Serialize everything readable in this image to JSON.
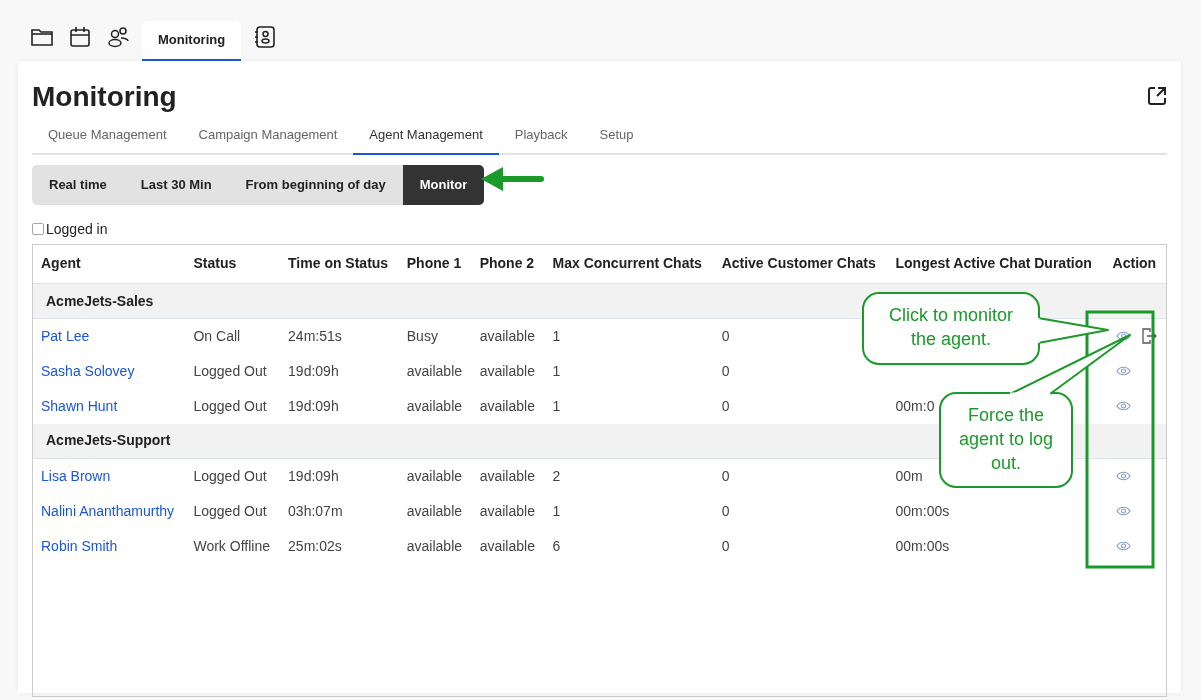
{
  "app_tabs": [
    {
      "kind": "folder",
      "selected": false
    },
    {
      "kind": "calendar",
      "selected": false
    },
    {
      "kind": "people",
      "selected": false
    },
    {
      "kind": "text",
      "label": "Monitoring",
      "selected": true
    },
    {
      "kind": "contact",
      "selected": false
    }
  ],
  "page": {
    "title": "Monitoring"
  },
  "tabs": [
    {
      "label": "Queue Management",
      "selected": false
    },
    {
      "label": "Campaign Management",
      "selected": false
    },
    {
      "label": "Agent Management",
      "selected": true
    },
    {
      "label": "Playback",
      "selected": false
    },
    {
      "label": "Setup",
      "selected": false
    }
  ],
  "modes": [
    {
      "label": "Real time",
      "selected": false
    },
    {
      "label": "Last 30 Min",
      "selected": false
    },
    {
      "label": "From beginning of day",
      "selected": false
    },
    {
      "label": "Monitor",
      "selected": true
    }
  ],
  "filter": {
    "label": "Logged in",
    "checked": false
  },
  "table": {
    "columns": [
      "Agent",
      "Status",
      "Time on Status",
      "Phone 1",
      "Phone 2",
      "Max Concurrent Chats",
      "Active Customer Chats",
      "Longest Active Chat Duration",
      "Action"
    ],
    "groups": [
      {
        "name": "AcmeJets-Sales",
        "rows": [
          {
            "agent": "Pat Lee",
            "status": "On Call",
            "time": "24m:51s",
            "phone1": "Busy",
            "phone2": "available",
            "max": "1",
            "active": "0",
            "longest": "",
            "actions": [
              {
                "kind": "monitor"
              },
              {
                "kind": "logout"
              }
            ]
          },
          {
            "agent": "Sasha Solovey",
            "status": "Logged Out",
            "time": "19d:09h",
            "phone1": "available",
            "phone2": "available",
            "max": "1",
            "active": "0",
            "longest": "",
            "actions": [
              {
                "kind": "monitor"
              }
            ]
          },
          {
            "agent": "Shawn Hunt",
            "status": "Logged Out",
            "time": "19d:09h",
            "phone1": "available",
            "phone2": "available",
            "max": "1",
            "active": "0",
            "longest": "00m:0",
            "actions": [
              {
                "kind": "monitor"
              }
            ]
          }
        ]
      },
      {
        "name": "AcmeJets-Support",
        "rows": [
          {
            "agent": "Lisa Brown",
            "status": "Logged Out",
            "time": "19d:09h",
            "phone1": "available",
            "phone2": "available",
            "max": "2",
            "active": "0",
            "longest": "00m",
            "actions": [
              {
                "kind": "monitor"
              }
            ]
          },
          {
            "agent": "Nalini Ananthamurthy",
            "status": "Logged Out",
            "time": "03h:07m",
            "phone1": "available",
            "phone2": "available",
            "max": "1",
            "active": "0",
            "longest": "00m:00s",
            "actions": [
              {
                "kind": "monitor"
              }
            ]
          },
          {
            "agent": "Robin Smith",
            "status": "Work Offline",
            "time": "25m:02s",
            "phone1": "available",
            "phone2": "available",
            "max": "6",
            "active": "0",
            "longest": "00m:00s",
            "actions": [
              {
                "kind": "monitor"
              }
            ]
          }
        ]
      }
    ]
  },
  "annotations": [
    {
      "kind": "callout",
      "text": "Click to monitor the agent."
    },
    {
      "kind": "callout",
      "text": "Force the agent to log out."
    }
  ]
}
